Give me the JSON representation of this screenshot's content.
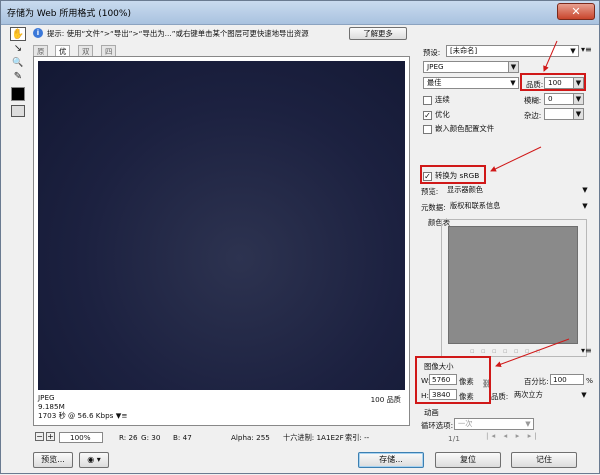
{
  "window": {
    "title": "存储为 Web 所用格式 (100%)",
    "close": "✕"
  },
  "hint": {
    "icon": "i",
    "prefix": "提示:",
    "text": "使用“文件”>“导出”>“导出为...”或右键单击某个图层可更快速地导出资源",
    "learn_more": "了解更多"
  },
  "tools": {
    "hand": "✋",
    "slice_select": "↘",
    "zoom": "🔍",
    "eyedropper": "✎"
  },
  "tabs": [
    "原稿",
    "优化",
    "双联",
    "四联"
  ],
  "active_tab": 1,
  "canvas_info": {
    "format": "JPEG",
    "size": "9.185M",
    "time": "1703 秒 @ 56.6 Kbps",
    "menu_icon": "▼≡",
    "quality_label": "100 品质"
  },
  "statusbar": {
    "zoom": "100%",
    "r": "R: 26",
    "g": "G: 30",
    "b": "B: 47",
    "alpha": "Alpha: 255",
    "hex": "十六进制: 1A1E2F",
    "index": "索引: --"
  },
  "buttons": {
    "preview": "预览...",
    "browser": "◉",
    "save": "存储...",
    "reset": "复位",
    "remember": "记住"
  },
  "settings": {
    "preset_label": "预设:",
    "preset_value": "[未命名]",
    "format": "JPEG",
    "quality_preset": "最佳",
    "quality_label": "品质:",
    "quality_value": "100",
    "progressive": "连续",
    "progressive_checked": false,
    "blur_label": "模糊:",
    "blur_value": "0",
    "optimized": "优化",
    "optimized_checked": true,
    "matte_label": "杂边:",
    "embed_profile": "嵌入颜色配置文件",
    "embed_checked": false,
    "convert_srgb": "转换为 sRGB",
    "convert_checked": true,
    "preview_label": "预览:",
    "preview_value": "显示器颜色",
    "metadata_label": "元数据:",
    "metadata_value": "版权和联系信息",
    "color_table": "颜色表",
    "image_size": "图像大小",
    "w_label": "W:",
    "w_value": "5760",
    "h_label": "H:",
    "h_value": "3840",
    "unit": "像素",
    "percent_label": "百分比:",
    "percent_value": "100",
    "percent_unit": "%",
    "quality2_label": "品质:",
    "quality2_value": "两次立方",
    "animation": "动画",
    "loop_label": "循环选项:",
    "loop_value": "一次",
    "frame_counter": "1/1"
  },
  "colors": {
    "highlight": "#d01818",
    "canvas": "#1A1E2F"
  }
}
